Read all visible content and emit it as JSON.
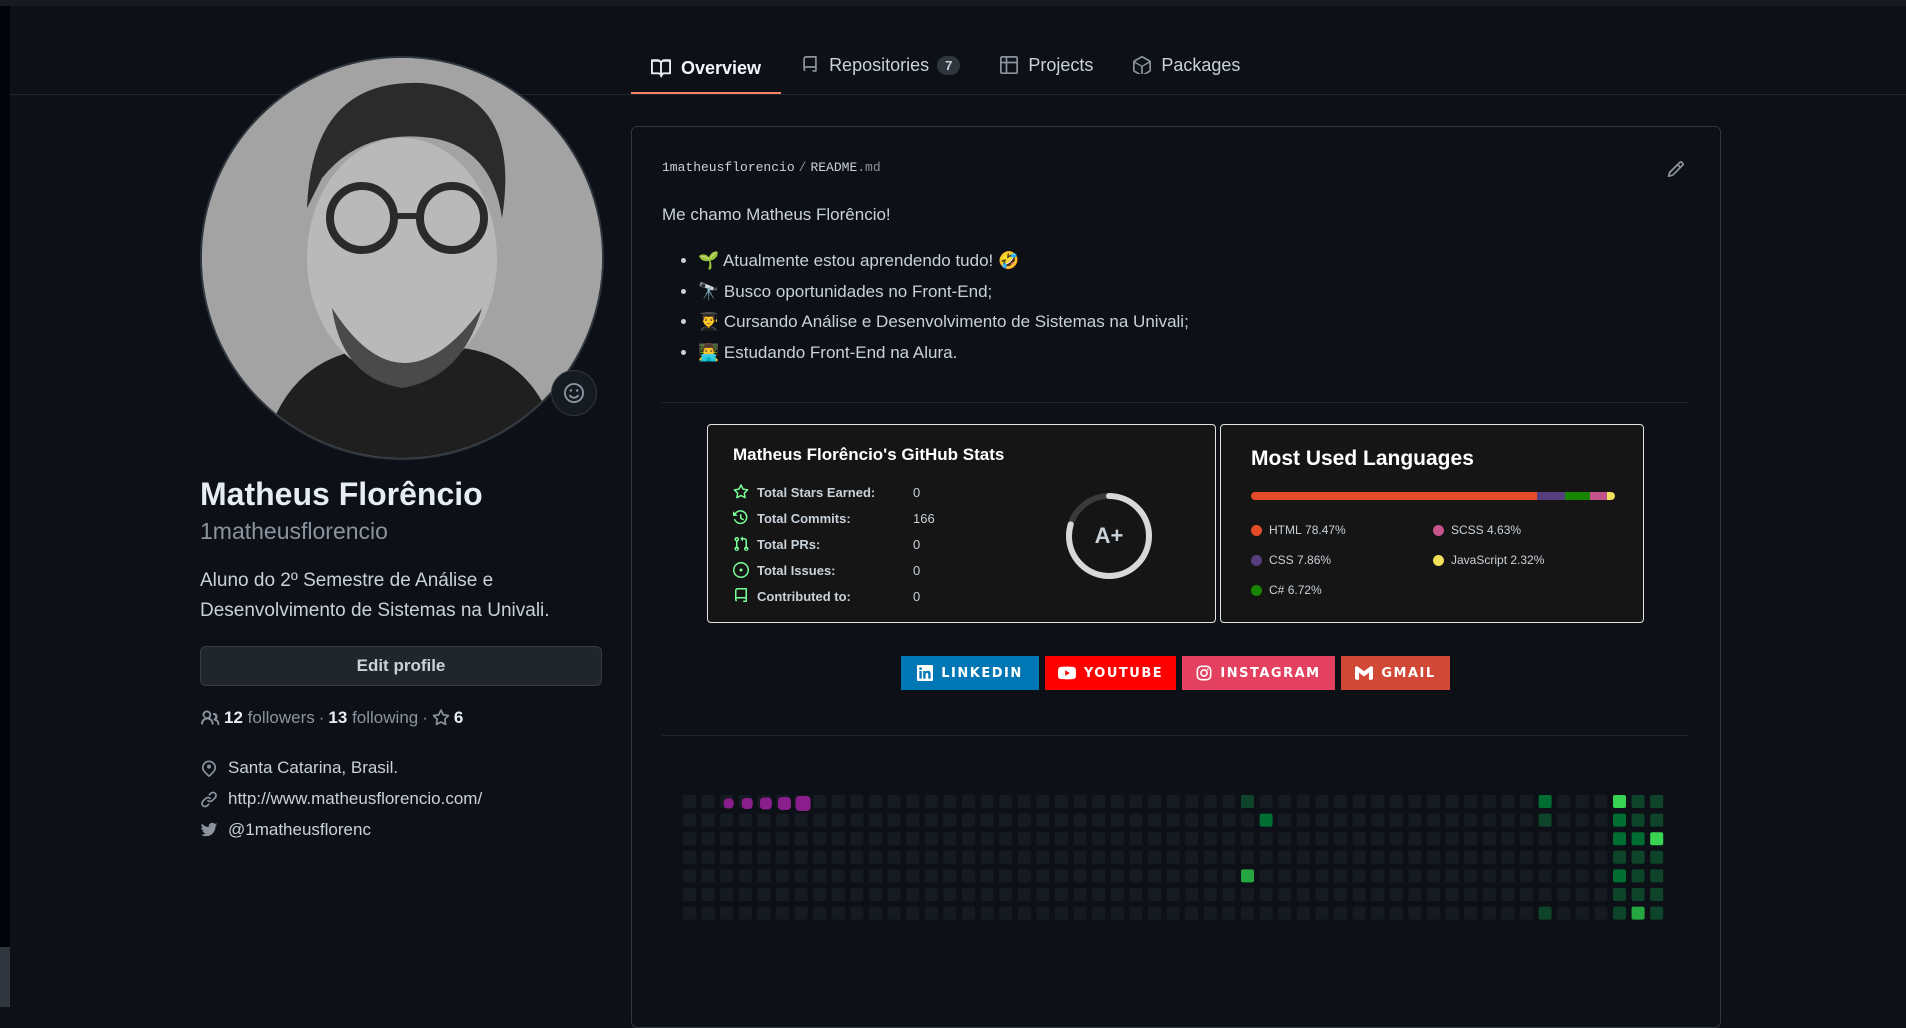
{
  "tabs": [
    {
      "label": "Overview",
      "icon": "book-icon",
      "active": true
    },
    {
      "label": "Repositories",
      "icon": "repo-icon",
      "count": "7"
    },
    {
      "label": "Projects",
      "icon": "table-icon"
    },
    {
      "label": "Packages",
      "icon": "package-icon"
    }
  ],
  "profile": {
    "name": "Matheus Florêncio",
    "login": "1matheusflorencio",
    "bio": "Aluno do 2º Semestre de Análise e Desenvolvimento de Sistemas na Univali.",
    "edit_label": "Edit profile",
    "followers_count": "12",
    "followers_label": "followers",
    "following_count": "13",
    "following_label": "following",
    "stars_count": "6",
    "location": "Santa Catarina, Brasil.",
    "website": "http://www.matheusflorencio.com/",
    "twitter": "@1matheusflorenc"
  },
  "readme": {
    "owner": "1matheusflorencio",
    "file": "README",
    "ext": ".md",
    "intro": "Me chamo Matheus Florêncio!",
    "bullets": [
      "🌱 Atualmente estou aprendendo tudo! 🤣",
      "🔭 Busco oportunidades no Front-End;",
      "👨‍🎓 Cursando Análise e Desenvolvimento de Sistemas na Univali;",
      "👨‍💻 Estudando Front-End na Alura."
    ]
  },
  "stats": {
    "title": "Matheus Florêncio's GitHub Stats",
    "rows": [
      {
        "label": "Total Stars Earned:",
        "value": "0",
        "icon": "star-icon"
      },
      {
        "label": "Total Commits:",
        "value": "166",
        "icon": "history-icon"
      },
      {
        "label": "Total PRs:",
        "value": "0",
        "icon": "pull-request-icon"
      },
      {
        "label": "Total Issues:",
        "value": "0",
        "icon": "issue-icon"
      },
      {
        "label": "Contributed to:",
        "value": "0",
        "icon": "repo-icon"
      }
    ],
    "grade": "A+",
    "accent_color": "#79ff97"
  },
  "languages": {
    "title": "Most Used Languages",
    "items": [
      {
        "name": "HTML",
        "percent": "78.47%",
        "value": 78.47,
        "color": "#e34c26"
      },
      {
        "name": "CSS",
        "percent": "7.86%",
        "value": 7.86,
        "color": "#563d7c"
      },
      {
        "name": "C#",
        "percent": "6.72%",
        "value": 6.72,
        "color": "#178600"
      },
      {
        "name": "SCSS",
        "percent": "4.63%",
        "value": 4.63,
        "color": "#c6538c"
      },
      {
        "name": "JavaScript",
        "percent": "2.32%",
        "value": 2.32,
        "color": "#f1e05a"
      }
    ]
  },
  "badges": [
    {
      "label": "LINKEDIN",
      "color": "#0077b5",
      "icon": "linkedin-icon"
    },
    {
      "label": "YOUTUBE",
      "color": "#ff0000",
      "icon": "youtube-icon"
    },
    {
      "label": "INSTAGRAM",
      "color": "#e4405f",
      "icon": "instagram-icon"
    },
    {
      "label": "GMAIL",
      "color": "#d14836",
      "icon": "gmail-icon"
    }
  ]
}
